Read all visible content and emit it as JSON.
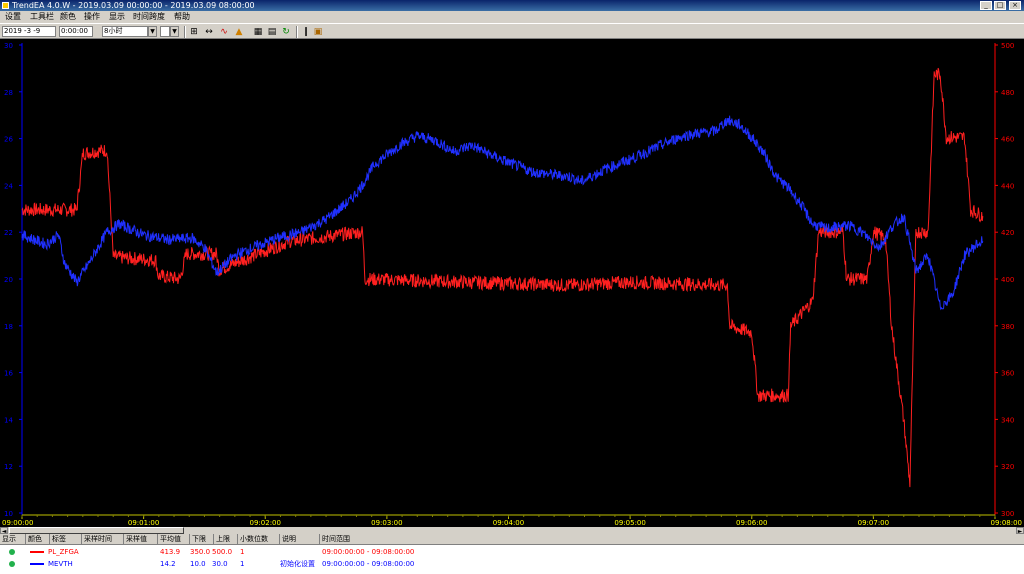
{
  "window": {
    "title": "TrendEA 4.0.W - 2019.03.09 00:00:00 - 2019.03.09 08:00:00",
    "buttons": [
      "_",
      "□",
      "×"
    ]
  },
  "menu": [
    "设置",
    "工具栏",
    "颜色",
    "操作",
    "显示",
    "时间跨度",
    "帮助"
  ],
  "toolbar": {
    "date_value": "2019 -3 -9",
    "time_value": "0:00:00",
    "span_value": "8小时",
    "zoom_value": "",
    "icons": [
      "chart-icon",
      "cursor-icon",
      "wave-icon",
      "peak-icon",
      "grid-icon",
      "print-icon",
      "refresh-icon",
      "bar-icon",
      "export-icon"
    ]
  },
  "chart_data": {
    "type": "line",
    "x_start": "09:00:00",
    "x_end": "09:08:00",
    "x_ticks": [
      "09:00:00",
      "09:01:00",
      "09:02:00",
      "09:03:00",
      "09:04:00",
      "09:05:00",
      "09:06:00",
      "09:07:00",
      "09:08:00"
    ],
    "left_axis": {
      "color": "#0000ff",
      "ylim": [
        0,
        30
      ],
      "ticks": [
        "30",
        "28",
        "26",
        "24",
        "22",
        "20",
        "18",
        "16",
        "14",
        "12",
        "10"
      ]
    },
    "right_axis": {
      "color": "#ff0000",
      "ylim": [
        350,
        500
      ],
      "ticks": [
        "500",
        "480",
        "460",
        "440",
        "420",
        "400",
        "380",
        "360",
        "340",
        "320",
        "300"
      ]
    },
    "series": [
      {
        "name": "PL_ZFGA",
        "color": "#ff2020",
        "axis": "right",
        "points": [
          [
            0,
            447
          ],
          [
            0.45,
            447
          ],
          [
            0.5,
            465
          ],
          [
            0.7,
            466
          ],
          [
            0.75,
            432
          ],
          [
            1.1,
            431
          ],
          [
            1.12,
            426
          ],
          [
            1.3,
            425
          ],
          [
            1.35,
            433
          ],
          [
            1.6,
            433
          ],
          [
            1.62,
            428
          ],
          [
            2.2,
            437
          ],
          [
            2.8,
            440
          ],
          [
            2.82,
            425
          ],
          [
            4.5,
            423
          ],
          [
            5.0,
            424
          ],
          [
            5.8,
            423
          ],
          [
            5.82,
            410
          ],
          [
            6.0,
            408
          ],
          [
            6.05,
            388
          ],
          [
            6.3,
            388
          ],
          [
            6.32,
            410
          ],
          [
            6.5,
            418
          ],
          [
            6.55,
            440
          ],
          [
            6.75,
            440
          ],
          [
            6.78,
            425
          ],
          [
            6.95,
            425
          ],
          [
            7.0,
            440
          ],
          [
            7.1,
            438
          ],
          [
            7.15,
            410
          ],
          [
            7.25,
            380
          ],
          [
            7.3,
            360
          ],
          [
            7.35,
            440
          ],
          [
            7.45,
            440
          ],
          [
            7.5,
            490
          ],
          [
            7.55,
            490
          ],
          [
            7.6,
            470
          ],
          [
            7.75,
            470
          ],
          [
            7.8,
            447
          ],
          [
            7.9,
            445
          ]
        ]
      },
      {
        "name": "MEVTH",
        "color": "#2030ff",
        "axis": "left",
        "points": [
          [
            0,
            17.8
          ],
          [
            0.2,
            17.2
          ],
          [
            0.3,
            17.8
          ],
          [
            0.35,
            16.0
          ],
          [
            0.45,
            14.8
          ],
          [
            0.55,
            16.0
          ],
          [
            0.7,
            18.0
          ],
          [
            0.8,
            18.5
          ],
          [
            1.0,
            17.8
          ],
          [
            1.2,
            17.5
          ],
          [
            1.4,
            17.6
          ],
          [
            1.5,
            17.0
          ],
          [
            1.6,
            15.4
          ],
          [
            1.75,
            16.5
          ],
          [
            1.9,
            17.0
          ],
          [
            2.1,
            17.6
          ],
          [
            2.3,
            18.0
          ],
          [
            2.5,
            18.8
          ],
          [
            2.7,
            20.0
          ],
          [
            2.8,
            21.0
          ],
          [
            2.9,
            22.3
          ],
          [
            3.1,
            23.5
          ],
          [
            3.25,
            24.1
          ],
          [
            3.4,
            23.8
          ],
          [
            3.55,
            23.1
          ],
          [
            3.7,
            23.5
          ],
          [
            3.85,
            22.9
          ],
          [
            4.0,
            22.4
          ],
          [
            4.2,
            21.8
          ],
          [
            4.5,
            21.5
          ],
          [
            4.6,
            21.2
          ],
          [
            4.8,
            22.0
          ],
          [
            5.0,
            22.6
          ],
          [
            5.2,
            23.3
          ],
          [
            5.4,
            24.0
          ],
          [
            5.5,
            24.2
          ],
          [
            5.7,
            24.4
          ],
          [
            5.8,
            25.1
          ],
          [
            5.9,
            24.8
          ],
          [
            6.0,
            24.0
          ],
          [
            6.1,
            23.0
          ],
          [
            6.2,
            21.5
          ],
          [
            6.3,
            20.8
          ],
          [
            6.4,
            19.8
          ],
          [
            6.5,
            18.5
          ],
          [
            6.6,
            18.2
          ],
          [
            6.8,
            18.4
          ],
          [
            6.9,
            18.0
          ],
          [
            7.05,
            17.0
          ],
          [
            7.15,
            18.3
          ],
          [
            7.25,
            19.0
          ],
          [
            7.35,
            15.5
          ],
          [
            7.45,
            16.5
          ],
          [
            7.55,
            13.2
          ],
          [
            7.65,
            14.0
          ],
          [
            7.75,
            16.5
          ],
          [
            7.85,
            17.2
          ],
          [
            7.9,
            17.4
          ]
        ]
      }
    ]
  },
  "legend": {
    "headers": [
      "显示",
      "颜色",
      "标签",
      "采样时间",
      "采样值",
      "平均值",
      "下限",
      "上限",
      "小数位数",
      "说明",
      "时间范围"
    ],
    "rows": [
      {
        "label": "PL_ZFGA",
        "sample": "",
        "value": "413.9",
        "avg": "",
        "low": "350.0",
        "high": "500.0",
        "dec": "1",
        "desc": "",
        "range": "09:00:00:00 - 09:08:00:00",
        "color": "#ff0000"
      },
      {
        "label": "MEVTH",
        "sample": "",
        "value": "14.2",
        "avg": "",
        "low": "10.0",
        "high": "30.0",
        "dec": "1",
        "desc": "初始化设置",
        "range": "09:00:00:00 - 09:08:00:00",
        "color": "#0000ff"
      }
    ]
  }
}
